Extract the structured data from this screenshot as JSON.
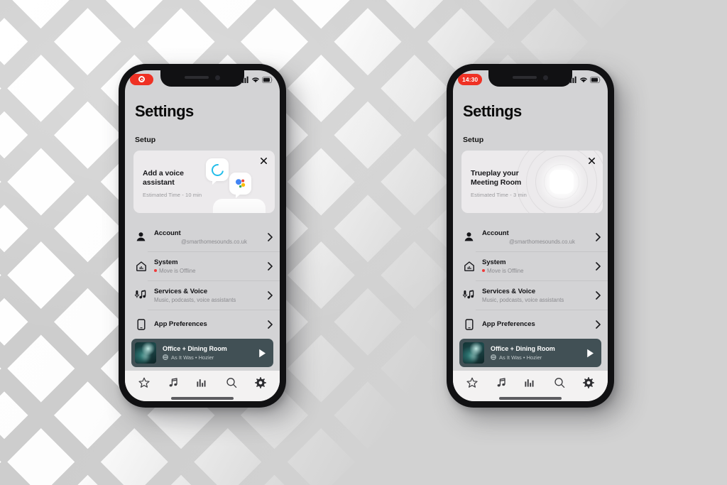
{
  "background": {
    "pattern": "diagonal-lattice",
    "base_color": "#d2d2d2",
    "lattice_color": "#cdcdcd"
  },
  "theme": {
    "accent_red": "#ef3124",
    "nowplaying_bg": "#415055",
    "screen_bg": "#d3d3d5",
    "card_bg": "#eceaec",
    "tabbar_bg": "#f3f2f2",
    "offline_dot": "#ef3a3a",
    "alexa_blue": "#22bdea"
  },
  "phones": [
    {
      "id": "phone-left",
      "status_bar": {
        "pill_type": "recording",
        "pill_label": "",
        "icons": [
          "cellular-icon",
          "wifi-icon",
          "battery-icon"
        ]
      },
      "page_title": "Settings",
      "section_label": "Setup",
      "setup_card": {
        "art": "voice-assistant",
        "title": "Add a voice assistant",
        "subtitle": "Estimated Time - 10 min",
        "close_label": "✕"
      }
    },
    {
      "id": "phone-right",
      "status_bar": {
        "pill_type": "time",
        "pill_label": "14:30",
        "icons": [
          "cellular-icon",
          "wifi-icon",
          "battery-icon"
        ]
      },
      "page_title": "Settings",
      "section_label": "Setup",
      "setup_card": {
        "art": "trueplay",
        "title": "Trueplay your Meeting Room",
        "subtitle": "Estimated Time - 3 min",
        "close_label": "✕"
      }
    }
  ],
  "settings_rows": [
    {
      "icon": "person-icon",
      "title": "Account",
      "subtitle": "@smarthomesounds.co.uk",
      "subtitle_indent": true,
      "status_dot": false
    },
    {
      "icon": "home-system-icon",
      "title": "System",
      "subtitle": "Move is Offline",
      "subtitle_indent": false,
      "status_dot": true
    },
    {
      "icon": "voice-music-icon",
      "title": "Services & Voice",
      "subtitle": "Music, podcasts, voice assistants",
      "subtitle_indent": false,
      "status_dot": false
    },
    {
      "icon": "phone-icon",
      "title": "App Preferences",
      "subtitle": "",
      "subtitle_indent": false,
      "status_dot": false
    }
  ],
  "now_playing": {
    "room": "Office + Dining Room",
    "track": "As It Was • Hozier",
    "play_label": "▶",
    "source_icon": "sonos-source-icon",
    "album_art": "album-art"
  },
  "tab_bar": {
    "items": [
      {
        "icon": "star-icon",
        "name": "favourites"
      },
      {
        "icon": "music-note-icon",
        "name": "browse"
      },
      {
        "icon": "equalizer-icon",
        "name": "rooms"
      },
      {
        "icon": "search-icon",
        "name": "search"
      },
      {
        "icon": "gear-icon",
        "name": "settings"
      }
    ]
  }
}
